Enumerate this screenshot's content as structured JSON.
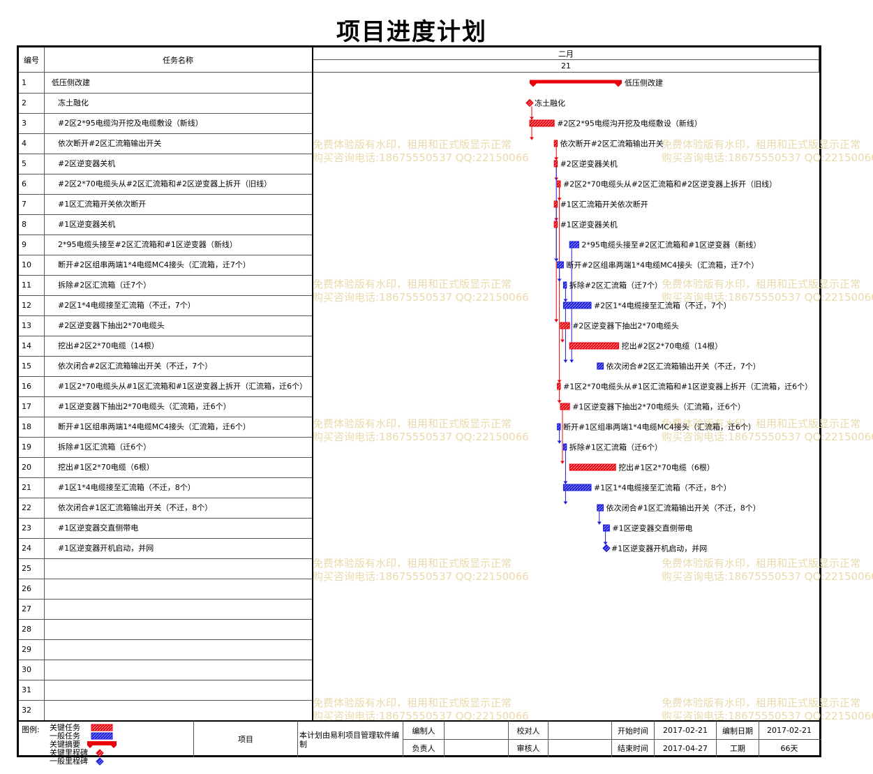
{
  "title": "项目进度计划",
  "header": {
    "col_num": "编号",
    "col_name": "任务名称",
    "month": "二月",
    "day": "21"
  },
  "tasks": [
    {
      "num": "1",
      "name": "低压侧改建",
      "kind": "summary"
    },
    {
      "num": "2",
      "name": "冻土融化",
      "kind": "milestone_crit"
    },
    {
      "num": "3",
      "name": "#2区2*95电缆沟开挖及电缆敷设（新线）",
      "kind": "crit"
    },
    {
      "num": "4",
      "name": "依次断开#2区汇流箱输出开关",
      "kind": "crit"
    },
    {
      "num": "5",
      "name": "#2区逆变器关机",
      "kind": "crit"
    },
    {
      "num": "6",
      "name": "#2区2*70电缆头从#2区汇流箱和#2区逆变器上拆开（旧线）",
      "kind": "crit"
    },
    {
      "num": "7",
      "name": "#1区汇流箱开关依次断开",
      "kind": "crit"
    },
    {
      "num": "8",
      "name": "#1区逆变器关机",
      "kind": "crit"
    },
    {
      "num": "9",
      "name": "2*95电缆头接至#2区汇流箱和#1区逆变器（新线）",
      "kind": "normal"
    },
    {
      "num": "10",
      "name": "断开#2区组串两端1*4电缆MC4接头（汇流箱，迁7个）",
      "kind": "normal"
    },
    {
      "num": "11",
      "name": "拆除#2区汇流箱（迁7个）",
      "kind": "normal"
    },
    {
      "num": "12",
      "name": "#2区1*4电缆接至汇流箱（不迁，7个）",
      "kind": "normal"
    },
    {
      "num": "13",
      "name": "#2区逆变器下抽出2*70电缆头",
      "kind": "crit"
    },
    {
      "num": "14",
      "name": "挖出#2区2*70电缆（14根）",
      "kind": "crit"
    },
    {
      "num": "15",
      "name": "依次闭合#2区汇流箱输出开关（不迁，7个）",
      "kind": "normal"
    },
    {
      "num": "16",
      "name": "#1区2*70电缆头从#1区汇流箱和#1区逆变器上拆开（汇流箱，迁6个）",
      "kind": "crit"
    },
    {
      "num": "17",
      "name": "#1区逆变器下抽出2*70电缆头（汇流箱，迁6个）",
      "kind": "crit"
    },
    {
      "num": "18",
      "name": "断开#1区组串两端1*4电缆MC4接头（汇流箱，迁6个）",
      "kind": "normal"
    },
    {
      "num": "19",
      "name": "拆除#1区汇流箱（迁6个）",
      "kind": "normal"
    },
    {
      "num": "20",
      "name": "挖出#1区2*70电缆（6根）",
      "kind": "crit"
    },
    {
      "num": "21",
      "name": "#1区1*4电缆接至汇流箱（不迁，8个）",
      "kind": "normal"
    },
    {
      "num": "22",
      "name": "依次闭合#1区汇流箱输出开关（不迁，8个）",
      "kind": "normal"
    },
    {
      "num": "23",
      "name": "#1区逆变器交直侧带电",
      "kind": "normal"
    },
    {
      "num": "24",
      "name": "#1区逆变器开机启动，并网",
      "kind": "milestone_norm"
    },
    {
      "num": "25",
      "name": ""
    },
    {
      "num": "26",
      "name": ""
    },
    {
      "num": "27",
      "name": ""
    },
    {
      "num": "28",
      "name": ""
    },
    {
      "num": "29",
      "name": ""
    },
    {
      "num": "30",
      "name": ""
    },
    {
      "num": "31",
      "name": ""
    },
    {
      "num": "32",
      "name": ""
    }
  ],
  "chart_data": {
    "type": "gantt",
    "title": "项目进度计划",
    "bars": [
      {
        "row": 1,
        "start": 0.0,
        "end": 0.3,
        "kind": "summary"
      },
      {
        "row": 2,
        "start": 0.0,
        "end": 0.0,
        "kind": "milestone_crit"
      },
      {
        "row": 3,
        "start": 0.0,
        "end": 0.08,
        "kind": "crit"
      },
      {
        "row": 4,
        "start": 0.08,
        "end": 0.09,
        "kind": "crit"
      },
      {
        "row": 5,
        "start": 0.08,
        "end": 0.09,
        "kind": "crit"
      },
      {
        "row": 6,
        "start": 0.09,
        "end": 0.1,
        "kind": "crit"
      },
      {
        "row": 7,
        "start": 0.08,
        "end": 0.09,
        "kind": "crit"
      },
      {
        "row": 8,
        "start": 0.08,
        "end": 0.09,
        "kind": "crit"
      },
      {
        "row": 9,
        "start": 0.13,
        "end": 0.16,
        "kind": "normal"
      },
      {
        "row": 10,
        "start": 0.09,
        "end": 0.11,
        "kind": "normal"
      },
      {
        "row": 11,
        "start": 0.11,
        "end": 0.12,
        "kind": "normal"
      },
      {
        "row": 12,
        "start": 0.11,
        "end": 0.2,
        "kind": "normal"
      },
      {
        "row": 13,
        "start": 0.1,
        "end": 0.13,
        "kind": "crit"
      },
      {
        "row": 14,
        "start": 0.13,
        "end": 0.29,
        "kind": "crit"
      },
      {
        "row": 15,
        "start": 0.22,
        "end": 0.24,
        "kind": "normal"
      },
      {
        "row": 16,
        "start": 0.09,
        "end": 0.1,
        "kind": "crit"
      },
      {
        "row": 17,
        "start": 0.1,
        "end": 0.13,
        "kind": "crit"
      },
      {
        "row": 18,
        "start": 0.09,
        "end": 0.1,
        "kind": "normal"
      },
      {
        "row": 19,
        "start": 0.11,
        "end": 0.12,
        "kind": "normal"
      },
      {
        "row": 20,
        "start": 0.13,
        "end": 0.28,
        "kind": "crit"
      },
      {
        "row": 21,
        "start": 0.11,
        "end": 0.2,
        "kind": "normal"
      },
      {
        "row": 22,
        "start": 0.22,
        "end": 0.24,
        "kind": "normal"
      },
      {
        "row": 23,
        "start": 0.24,
        "end": 0.26,
        "kind": "normal"
      },
      {
        "row": 24,
        "start": 0.25,
        "end": 0.25,
        "kind": "milestone_norm"
      }
    ],
    "colors": {
      "crit": "#e8000b",
      "normal": "#1a1adb"
    }
  },
  "watermark": {
    "line1": "免费体验版有水印，租用和正式版显示正常",
    "line2": "购买咨询电话:18675550537 QQ:22150066"
  },
  "legend": {
    "title": "图例:",
    "items": [
      "关键任务",
      "一般任务",
      "关键摘要",
      "关键里程碑",
      "一般里程碑"
    ]
  },
  "footer": {
    "project_label": "项目",
    "made_by_software": "本计划由易利项目管理软件编制",
    "compiler": "编制人",
    "checker": "校对人",
    "start_label": "开始时间",
    "start_value": "2017-02-21",
    "date_label": "编制日期",
    "date_value": "2017-02-21",
    "owner": "负责人",
    "reviewer": "审核人",
    "end_label": "结束时间",
    "end_value": "2017-04-27",
    "duration_label": "工期",
    "duration_value": "66天"
  }
}
